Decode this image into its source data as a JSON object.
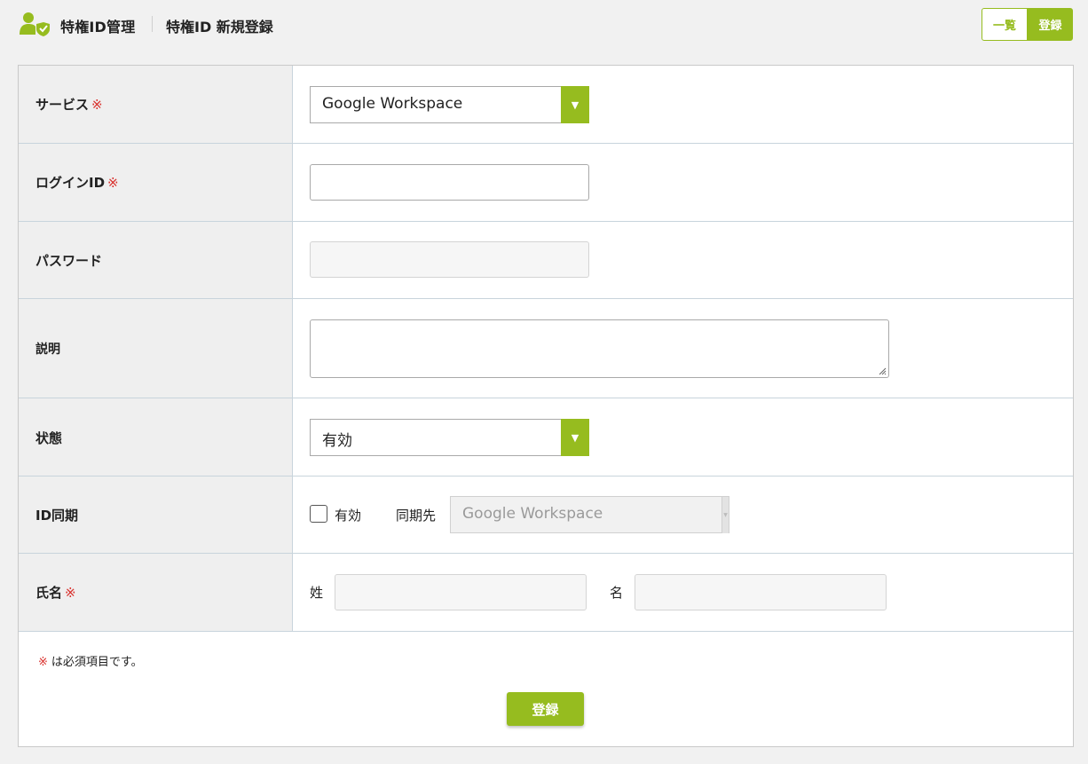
{
  "header": {
    "app_icon": "user-shield-icon",
    "app_title": "特権ID管理",
    "page_title": "特権ID 新規登録",
    "list_button": "一覧",
    "register_button": "登録"
  },
  "colors": {
    "accent": "#96bc1f",
    "required": "#d9302c",
    "label_bg": "#efefef",
    "page_bg": "#f1f1f1"
  },
  "form": {
    "required_mark": "※",
    "service": {
      "label": "サービス",
      "required": true,
      "value": "Google Workspace"
    },
    "login_id": {
      "label": "ログインID",
      "required": true,
      "value": "",
      "placeholder": ""
    },
    "password": {
      "label": "パスワード",
      "required": false,
      "value": "",
      "placeholder": "",
      "disabled": true
    },
    "description": {
      "label": "説明",
      "required": false,
      "value": "",
      "placeholder": ""
    },
    "status": {
      "label": "状態",
      "required": false,
      "value": "有効"
    },
    "id_sync": {
      "label": "ID同期",
      "checkbox_label": "有効",
      "checked": false,
      "target_label": "同期先",
      "target_value": "Google Workspace",
      "target_disabled": true
    },
    "full_name": {
      "label": "氏名",
      "required": true,
      "last_name_label": "姓",
      "last_name_value": "",
      "first_name_label": "名",
      "first_name_value": ""
    }
  },
  "footer": {
    "required_note": "は必須項目です。",
    "submit_button": "登録"
  }
}
